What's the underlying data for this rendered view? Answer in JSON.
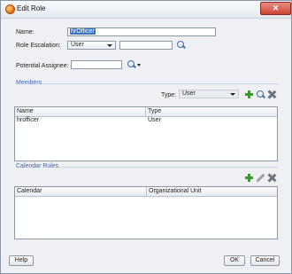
{
  "window": {
    "title": "Edit Role",
    "close_label": "✕"
  },
  "form": {
    "name_label": "Name:",
    "name_value": "hrOfficer",
    "escalation_label": "Role Escalation:",
    "escalation_type": "User",
    "escalation_value": "",
    "assignee_label": "Potential Assignee:",
    "assignee_value": ""
  },
  "members": {
    "section_title": "Members",
    "type_label": "Type:",
    "type_value": "User",
    "columns": [
      "Name",
      "Type"
    ],
    "rows": [
      {
        "name": "hrofficer",
        "type": "User"
      }
    ]
  },
  "calendar": {
    "section_title": "Calendar Rules",
    "columns": [
      "Calendar",
      "Organizational Unit"
    ],
    "rows": []
  },
  "footer": {
    "help_label": "Help",
    "ok_label": "OK",
    "cancel_label": "Cancel"
  }
}
